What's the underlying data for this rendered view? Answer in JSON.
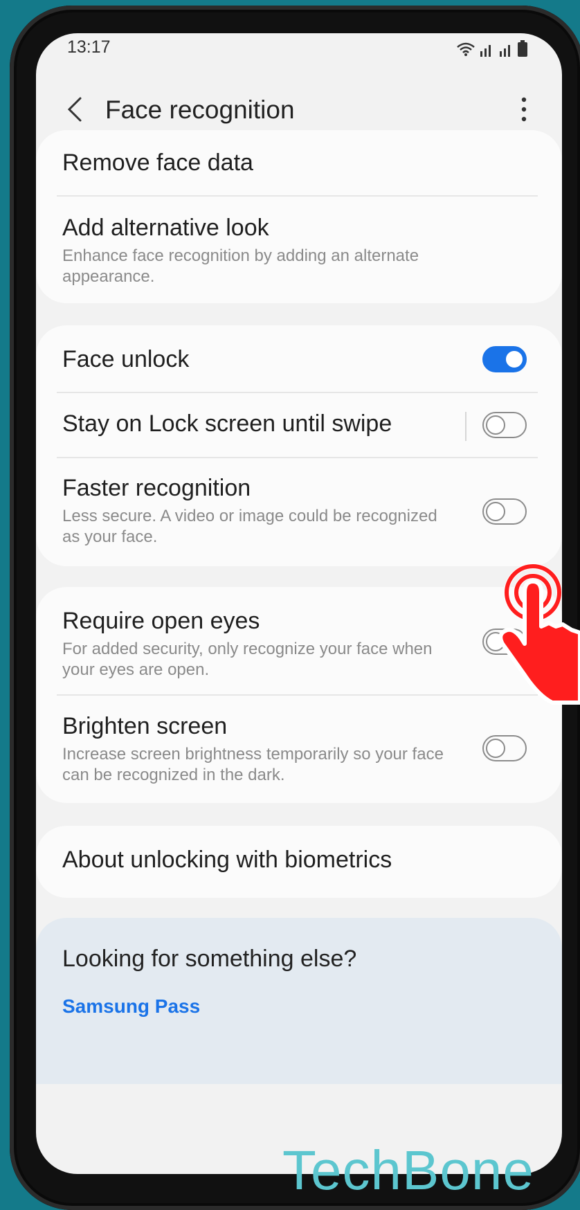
{
  "status_bar": {
    "time": "13:17"
  },
  "header": {
    "title": "Face recognition"
  },
  "card1": {
    "remove": "Remove face data",
    "alt_title": "Add alternative look",
    "alt_sub": "Enhance face recognition by adding an alternate appearance."
  },
  "card2": {
    "face_unlock": {
      "label": "Face unlock",
      "enabled": true
    },
    "stay_on_lock": {
      "label": "Stay on Lock screen until swipe",
      "enabled": false
    },
    "faster": {
      "label": "Faster recognition",
      "sub": "Less secure. A video or image could be recognized as your face.",
      "enabled": false
    }
  },
  "card3": {
    "open_eyes": {
      "label": "Require open eyes",
      "sub": "For added security, only recognize your face when your eyes are open.",
      "enabled": false
    },
    "brighten": {
      "label": "Brighten screen",
      "sub": "Increase screen brightness temporarily so your face can be recognized in the dark.",
      "enabled": false
    }
  },
  "card4": {
    "about": "About unlocking with biometrics"
  },
  "suggest": {
    "question": "Looking for something else?",
    "link": "Samsung Pass"
  },
  "watermark": "TechBone",
  "colors": {
    "accent": "#1a73e8",
    "background": "#147a8a",
    "pointer": "#ff1e1e"
  },
  "icons": [
    "back-arrow-icon",
    "more-vert-icon",
    "wifi-icon",
    "signal-icon",
    "battery-icon",
    "tap-hand-icon"
  ]
}
